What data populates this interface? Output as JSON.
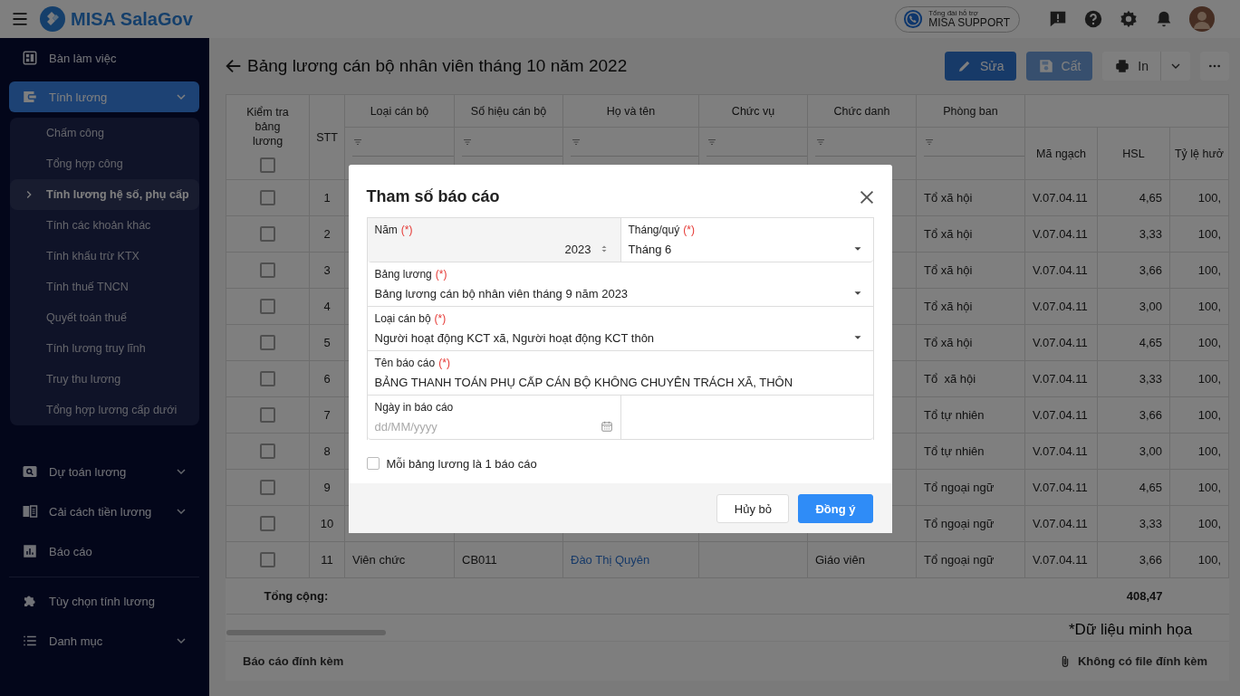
{
  "header": {
    "app_name": "MISA SalaGov",
    "support": {
      "caption": "Tổng đài hỗ trợ",
      "label": "MISA SUPPORT"
    }
  },
  "sidebar": {
    "sections": [
      {
        "items": [
          {
            "label": "Bàn làm việc",
            "selected": false
          },
          {
            "label": "Tính lương",
            "selected": true,
            "expanded": true,
            "children": [
              {
                "label": "Chấm công",
                "selected": false
              },
              {
                "label": "Tổng hợp công",
                "selected": false
              },
              {
                "label": "Tính lương hệ số, phụ cấp",
                "selected": true
              },
              {
                "label": "Tính các khoản khác",
                "selected": false
              },
              {
                "label": "Tính khấu trừ KTX",
                "selected": false
              },
              {
                "label": "Tính thuế TNCN",
                "selected": false
              },
              {
                "label": "Quyết toán thuế",
                "selected": false
              },
              {
                "label": "Tính lương truy lĩnh",
                "selected": false
              },
              {
                "label": "Truy thu lương",
                "selected": false
              },
              {
                "label": "Tổng hợp lương cấp dưới",
                "selected": false
              }
            ]
          },
          {
            "label": "Dự toán lương",
            "selected": false,
            "expanded": false
          },
          {
            "label": "Cải cách tiền lương",
            "selected": false,
            "expanded": false
          },
          {
            "label": "Báo cáo",
            "selected": false
          }
        ]
      },
      {
        "items": [
          {
            "label": "Tùy chọn tính lương",
            "selected": false
          },
          {
            "label": "Danh mục",
            "selected": false,
            "expanded": false
          }
        ]
      }
    ]
  },
  "page": {
    "title": "Bảng lương cán bộ nhân viên tháng 10 năm 2022",
    "toolbar": [
      {
        "kind": "primary",
        "label": "Sửa",
        "disabled": false
      },
      {
        "kind": "primary",
        "label": "Cất",
        "disabled": true
      },
      {
        "kind": "split",
        "label": "In"
      },
      {
        "kind": "more"
      }
    ]
  },
  "table": {
    "header_checked": false,
    "columns": [
      {
        "kind": "check",
        "label": "Kiểm tra bảng lương"
      },
      {
        "kind": "plain",
        "label": "STT"
      },
      {
        "kind": "filter",
        "label": "Loại cán bộ"
      },
      {
        "kind": "filter",
        "label": "Số hiệu cán bộ"
      },
      {
        "kind": "filter",
        "label": "Họ và tên"
      },
      {
        "kind": "filter",
        "label": "Chức vụ"
      },
      {
        "kind": "filter",
        "label": "Chức danh"
      },
      {
        "kind": "filter",
        "label": "Phòng ban"
      },
      {
        "kind": "grouped",
        "label": "Mã ngạch"
      },
      {
        "kind": "grouped",
        "label": "HSL"
      },
      {
        "kind": "grouped",
        "label": "Tỷ lệ hưở"
      }
    ],
    "rows": [
      {
        "checked": false,
        "stt": "1",
        "phong_ban": "Tổ xã hội",
        "ma_ngach": "V.07.04.11",
        "hsl": "4,65",
        "ty_le": "100,"
      },
      {
        "checked": false,
        "stt": "2",
        "phong_ban": "Tổ xã hội",
        "ma_ngach": "V.07.04.11",
        "hsl": "3,33",
        "ty_le": "100,"
      },
      {
        "checked": false,
        "stt": "3",
        "phong_ban": "Tổ xã hội",
        "ma_ngach": "V.07.04.11",
        "hsl": "3,66",
        "ty_le": "100,"
      },
      {
        "checked": false,
        "stt": "4",
        "phong_ban": "Tổ xã hội",
        "ma_ngach": "V.07.04.11",
        "hsl": "3,00",
        "ty_le": "100,"
      },
      {
        "checked": false,
        "stt": "5",
        "phong_ban": "Tổ xã hội",
        "ma_ngach": "V.07.04.11",
        "hsl": "4,65",
        "ty_le": "100,"
      },
      {
        "checked": false,
        "stt": "6",
        "phong_ban": "Tổ  xã hội",
        "ma_ngach": "V.07.04.11",
        "hsl": "3,33",
        "ty_le": "100,"
      },
      {
        "checked": false,
        "stt": "7",
        "phong_ban": "Tổ tự nhiên",
        "ma_ngach": "V.07.04.11",
        "hsl": "3,66",
        "ty_le": "100,"
      },
      {
        "checked": false,
        "stt": "8",
        "phong_ban": "Tổ tự nhiên",
        "ma_ngach": "V.07.04.11",
        "hsl": "3,00",
        "ty_le": "100,"
      },
      {
        "checked": false,
        "stt": "9",
        "phong_ban": "Tổ ngoại ngữ",
        "ma_ngach": "V.07.04.11",
        "hsl": "4,65",
        "ty_le": "100,"
      },
      {
        "checked": false,
        "stt": "10",
        "phong_ban": "Tổ ngoại ngữ",
        "ma_ngach": "V.07.04.11",
        "hsl": "3,33",
        "ty_le": "100,"
      },
      {
        "checked": false,
        "stt": "11",
        "loai": "Viên chức",
        "so_hieu": "CB011",
        "ho_ten": "Đào Thị Quyên",
        "chuc_danh": "Giáo viên",
        "phong_ban": "Tổ ngoại ngữ",
        "ma_ngach": "V.07.04.11",
        "hsl": "3,66",
        "ty_le": "100,"
      }
    ],
    "totals": {
      "label": "Tổng cộng:",
      "hsl": "408,47"
    }
  },
  "footer": {
    "label": "Báo cáo đính kèm",
    "status": "Không có file đính kèm"
  },
  "note": "*Dữ liệu minh họa",
  "modal": {
    "title": "Tham số báo cáo",
    "rows": [
      {
        "fields": [
          {
            "kind": "number",
            "label": "Năm",
            "required_mark": "(*)",
            "value": "2023"
          },
          {
            "kind": "select",
            "label": "Tháng/quý",
            "required_mark": "(*)",
            "value": "Tháng 6"
          }
        ]
      },
      {
        "fields": [
          {
            "kind": "select",
            "label": "Bảng lương",
            "required_mark": "(*)",
            "value": "Bảng lương cán bộ nhân viên tháng 9 năm 2023"
          }
        ]
      },
      {
        "fields": [
          {
            "kind": "select",
            "label": "Loại cán bộ",
            "required_mark": "(*)",
            "value": "Người hoạt động KCT xã, Người hoạt động KCT thôn"
          }
        ]
      },
      {
        "fields": [
          {
            "kind": "text",
            "label": "Tên báo cáo",
            "required_mark": "(*)",
            "value": "BẢNG THANH TOÁN PHỤ CẤP CÁN BỘ KHÔNG CHUYÊN TRÁCH XÃ, THÔN"
          }
        ]
      },
      {
        "fields": [
          {
            "kind": "date",
            "label": "Ngày in báo cáo",
            "placeholder": "dd/MM/yyyy"
          }
        ]
      }
    ],
    "option": {
      "label": "Mỗi bảng lương là 1 báo cáo",
      "checked": false
    },
    "buttons": [
      {
        "kind": "secondary",
        "label": "Hủy bỏ"
      },
      {
        "kind": "primary",
        "label": "Đồng ý"
      }
    ]
  }
}
